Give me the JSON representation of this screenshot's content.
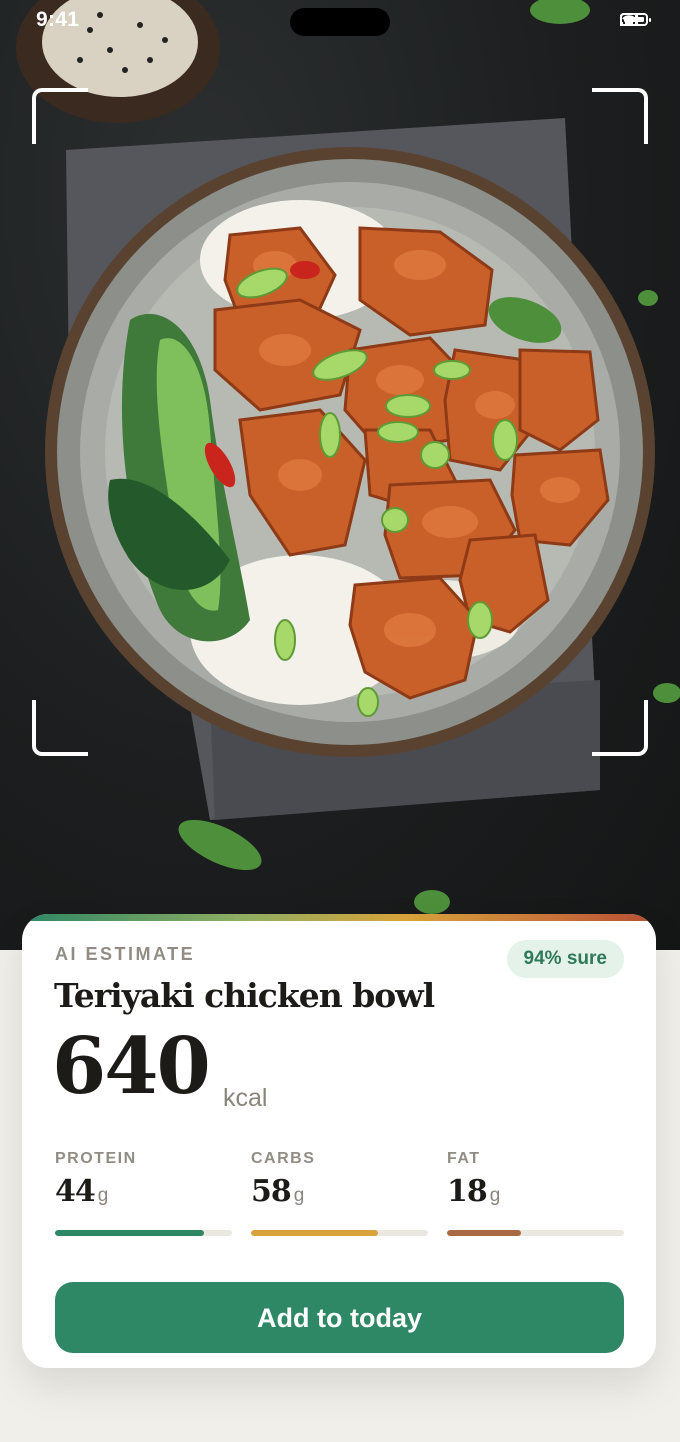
{
  "status_bar": {
    "time": "9:41"
  },
  "scan": {},
  "estimate": {
    "label": "AI ESTIMATE",
    "confidence": "94% sure",
    "dish_name": "Teriyaki chicken bowl",
    "calories": "640",
    "calories_unit": "kcal"
  },
  "macros": [
    {
      "label": "PROTEIN",
      "value": "44",
      "unit": "g",
      "fill_pct": 84,
      "color": "#2e8765"
    },
    {
      "label": "CARBS",
      "value": "58",
      "unit": "g",
      "fill_pct": 72,
      "color": "#d7a33a"
    },
    {
      "label": "FAT",
      "value": "18",
      "unit": "g",
      "fill_pct": 42,
      "color": "#a86a42"
    }
  ],
  "actions": {
    "add_label": "Add to today"
  },
  "colors": {
    "accent": "#2e8765",
    "badge_bg": "#e5f2ea",
    "badge_text": "#2e7a58"
  },
  "icons": [
    "signal-icon",
    "wifi-icon",
    "battery-icon"
  ]
}
